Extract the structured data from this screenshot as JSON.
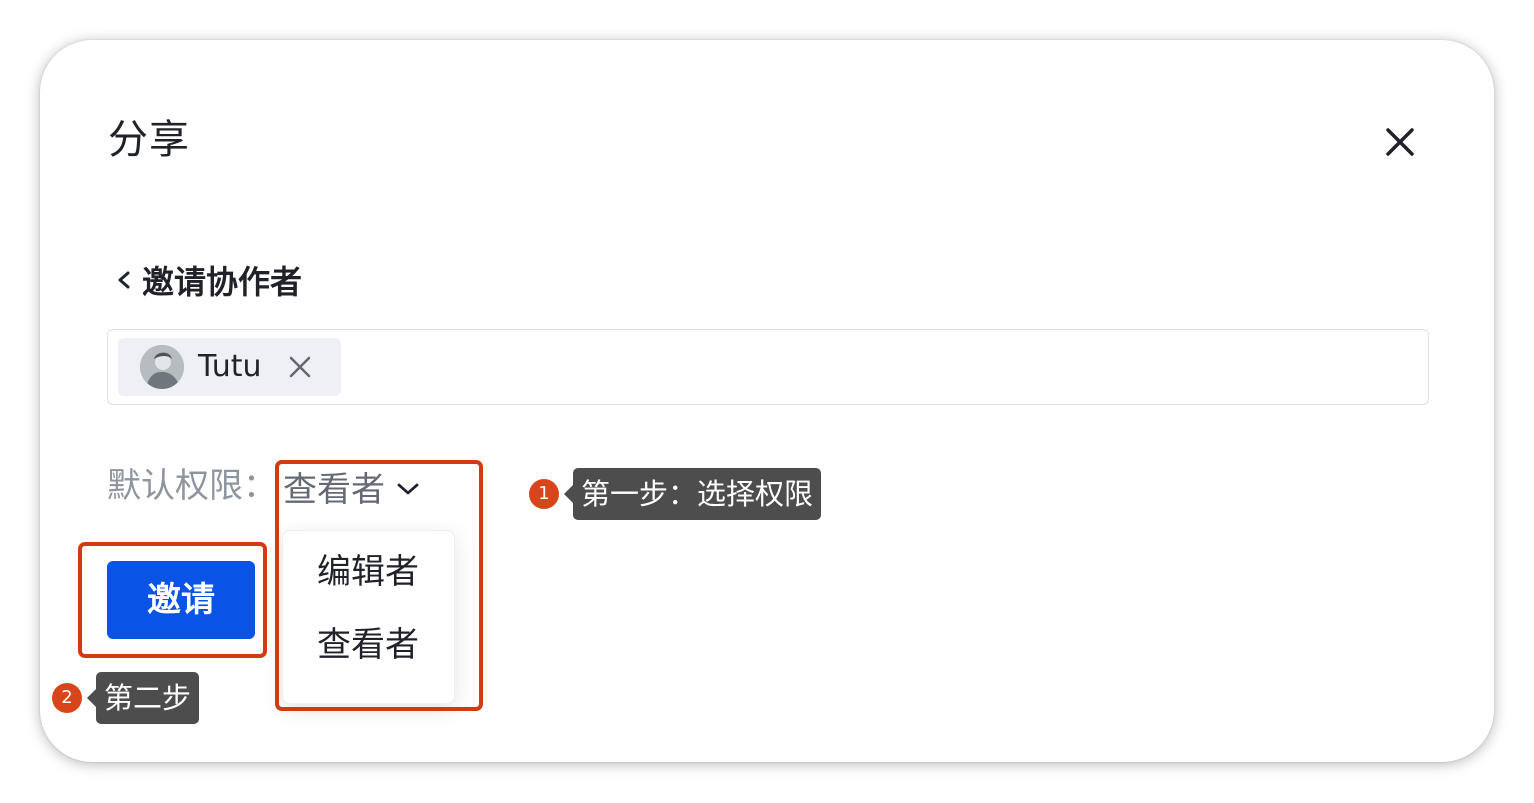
{
  "dialog": {
    "title": "分享",
    "close_icon": "close-icon"
  },
  "invite": {
    "back_label": "邀请协作者",
    "back_icon": "chevron-left-icon",
    "chip": {
      "name": "Tutu",
      "avatar_icon": "user-avatar",
      "remove_icon": "close-icon"
    },
    "permission_label": "默认权限：",
    "permission_value": "查看者",
    "permission_caret_icon": "chevron-down-icon",
    "permission_options": [
      "编辑者",
      "查看者"
    ],
    "invite_button": "邀请",
    "primary_color": "#0954e4"
  },
  "annotations": {
    "step1": {
      "number": "1",
      "text": "第一步：选择权限"
    },
    "step2": {
      "number": "2",
      "text": "第二步"
    },
    "highlight_color": "#d33a13"
  }
}
